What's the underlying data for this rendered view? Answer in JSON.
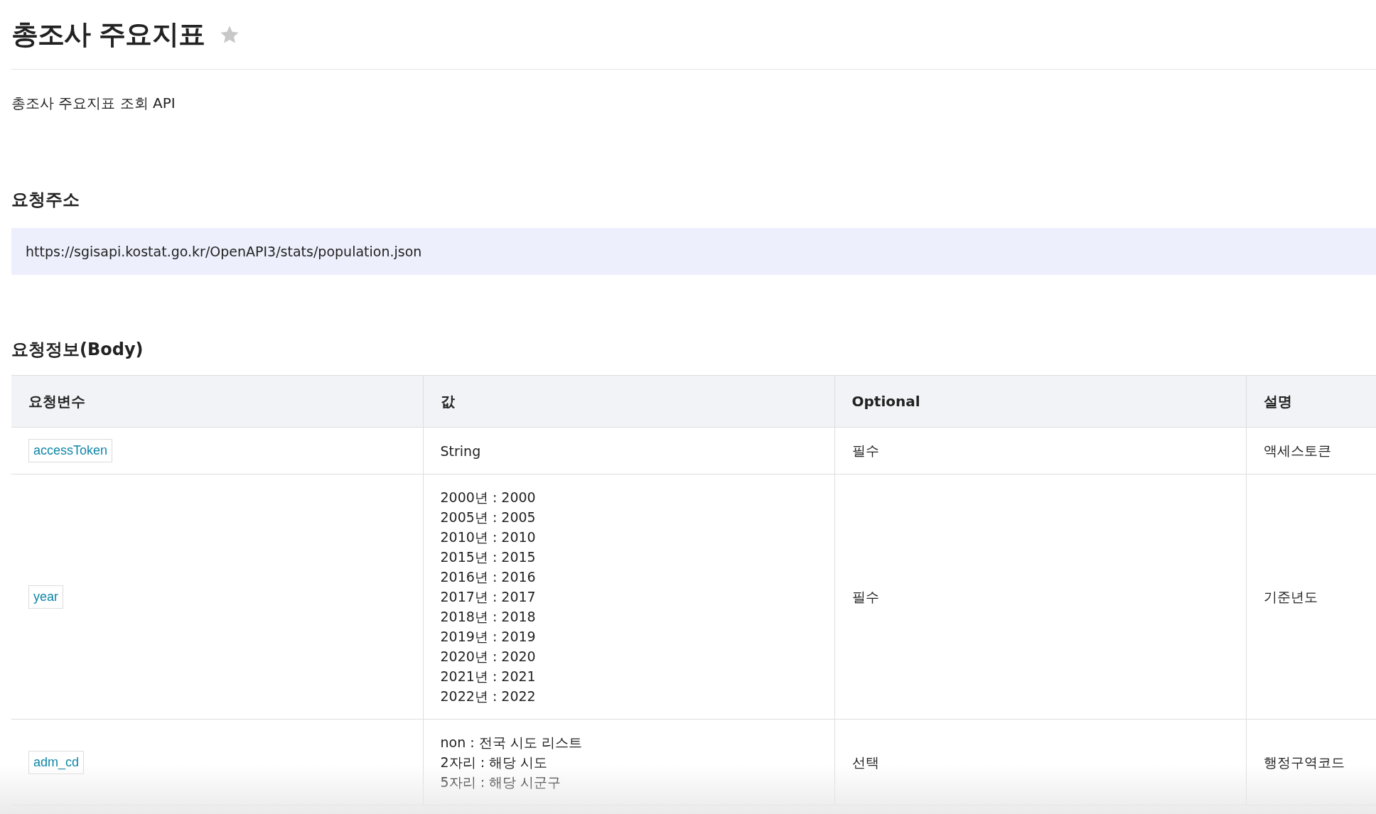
{
  "page": {
    "title": "총조사 주요지표",
    "favorite": false,
    "description": "총조사 주요지표 조회 API"
  },
  "request_url": {
    "heading": "요청주소",
    "url": "https://sgisapi.kostat.go.kr/OpenAPI3/stats/population.json"
  },
  "request_body": {
    "heading": "요청정보(Body)",
    "columns": [
      "요청변수",
      "값",
      "Optional",
      "설명"
    ],
    "rows": [
      {
        "param": "accessToken",
        "value": [
          "String"
        ],
        "optional": "필수",
        "description": "액세스토큰"
      },
      {
        "param": "year",
        "value": [
          "2000년 : 2000",
          "2005년 : 2005",
          "2010년 : 2010",
          "2015년 : 2015",
          "2016년 : 2016",
          "2017년 : 2017",
          "2018년 : 2018",
          "2019년 : 2019",
          "2020년 : 2020",
          "2021년 : 2021",
          "2022년 : 2022"
        ],
        "optional": "필수",
        "description": "기준년도"
      },
      {
        "param": "adm_cd",
        "value": [
          "non : 전국 시도 리스트",
          "2자리 : 해당 시도",
          "5자리 : 해당 시군구"
        ],
        "optional": "선택",
        "description": "행정구역코드"
      }
    ]
  }
}
